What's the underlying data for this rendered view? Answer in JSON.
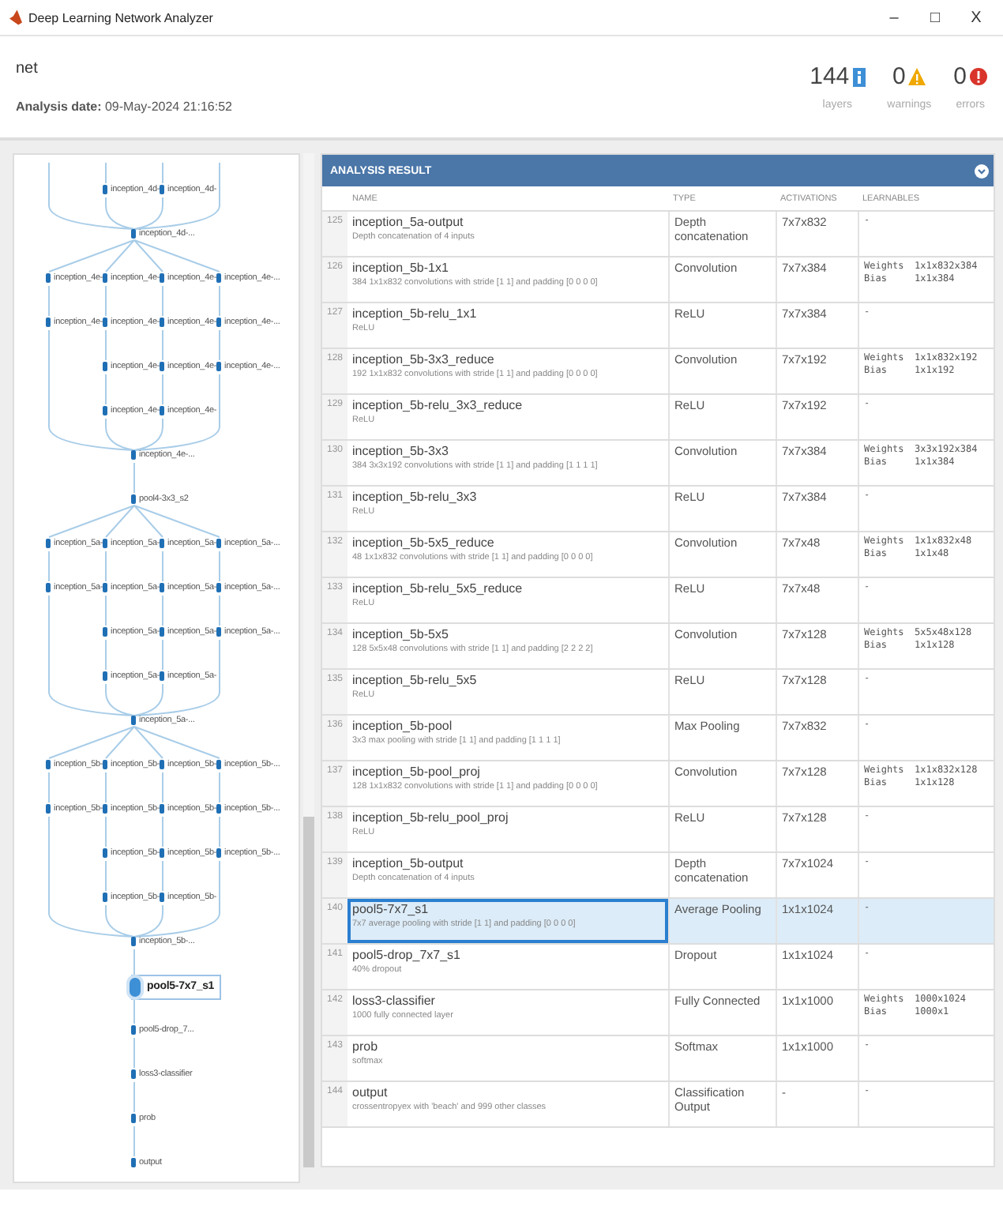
{
  "window": {
    "title": "Deep Learning Network Analyzer",
    "controls": [
      "–",
      "□",
      "X"
    ]
  },
  "header": {
    "network": "net",
    "analysis_date": "**Analysis date:** 09-May-2024 21:16:52",
    "stats": [
      {
        "kind": "info",
        "count": "144",
        "label": "layers"
      },
      {
        "kind": "warning",
        "count": "0",
        "label": "warnings"
      },
      {
        "kind": "error",
        "count": "0",
        "label": "errors"
      }
    ]
  },
  "graph": {
    "rows": [
      {
        "kind": "branch",
        "nodes": [
          {
            "kind": "gap"
          },
          {
            "kind": "node",
            "label": "inception_4d-",
            "selected": false
          },
          {
            "kind": "node",
            "label": "inception_4d-",
            "selected": false
          },
          {
            "kind": "gap"
          }
        ]
      },
      {
        "kind": "single",
        "node": {
          "label": "inception_4d-...",
          "selected": false
        }
      },
      {
        "kind": "branch",
        "nodes": [
          {
            "kind": "node",
            "label": "inception_4e-",
            "selected": false
          },
          {
            "kind": "node",
            "label": "inception_4e-",
            "selected": false
          },
          {
            "kind": "node",
            "label": "inception_4e-",
            "selected": false
          },
          {
            "kind": "node",
            "label": "inception_4e-...",
            "selected": false
          }
        ]
      },
      {
        "kind": "branch",
        "nodes": [
          {
            "kind": "node",
            "label": "inception_4e-",
            "selected": false
          },
          {
            "kind": "node",
            "label": "inception_4e-",
            "selected": false
          },
          {
            "kind": "node",
            "label": "inception_4e-",
            "selected": false
          },
          {
            "kind": "node",
            "label": "inception_4e-...",
            "selected": false
          }
        ]
      },
      {
        "kind": "branch",
        "nodes": [
          {
            "kind": "gap"
          },
          {
            "kind": "node",
            "label": "inception_4e-",
            "selected": false
          },
          {
            "kind": "node",
            "label": "inception_4e-",
            "selected": false
          },
          {
            "kind": "node",
            "label": "inception_4e-...",
            "selected": false
          }
        ]
      },
      {
        "kind": "branch",
        "nodes": [
          {
            "kind": "gap"
          },
          {
            "kind": "node",
            "label": "inception_4e-",
            "selected": false
          },
          {
            "kind": "node",
            "label": "inception_4e-",
            "selected": false
          },
          {
            "kind": "gap"
          }
        ]
      },
      {
        "kind": "single",
        "node": {
          "label": "inception_4e-...",
          "selected": false
        }
      },
      {
        "kind": "single",
        "node": {
          "label": "pool4-3x3_s2",
          "selected": false
        }
      },
      {
        "kind": "branch",
        "nodes": [
          {
            "kind": "node",
            "label": "inception_5a-",
            "selected": false
          },
          {
            "kind": "node",
            "label": "inception_5a-",
            "selected": false
          },
          {
            "kind": "node",
            "label": "inception_5a-",
            "selected": false
          },
          {
            "kind": "node",
            "label": "inception_5a-...",
            "selected": false
          }
        ]
      },
      {
        "kind": "branch",
        "nodes": [
          {
            "kind": "node",
            "label": "inception_5a-",
            "selected": false
          },
          {
            "kind": "node",
            "label": "inception_5a-",
            "selected": false
          },
          {
            "kind": "node",
            "label": "inception_5a-",
            "selected": false
          },
          {
            "kind": "node",
            "label": "inception_5a-...",
            "selected": false
          }
        ]
      },
      {
        "kind": "branch",
        "nodes": [
          {
            "kind": "gap"
          },
          {
            "kind": "node",
            "label": "inception_5a-",
            "selected": false
          },
          {
            "kind": "node",
            "label": "inception_5a-",
            "selected": false
          },
          {
            "kind": "node",
            "label": "inception_5a-...",
            "selected": false
          }
        ]
      },
      {
        "kind": "branch",
        "nodes": [
          {
            "kind": "gap"
          },
          {
            "kind": "node",
            "label": "inception_5a-",
            "selected": false
          },
          {
            "kind": "node",
            "label": "inception_5a-",
            "selected": false
          },
          {
            "kind": "gap"
          }
        ]
      },
      {
        "kind": "single",
        "node": {
          "label": "inception_5a-...",
          "selected": false
        }
      },
      {
        "kind": "branch",
        "nodes": [
          {
            "kind": "node",
            "label": "inception_5b-",
            "selected": false
          },
          {
            "kind": "node",
            "label": "inception_5b-",
            "selected": false
          },
          {
            "kind": "node",
            "label": "inception_5b-",
            "selected": false
          },
          {
            "kind": "node",
            "label": "inception_5b-...",
            "selected": false
          }
        ]
      },
      {
        "kind": "branch",
        "nodes": [
          {
            "kind": "node",
            "label": "inception_5b-",
            "selected": false
          },
          {
            "kind": "node",
            "label": "inception_5b-",
            "selected": false
          },
          {
            "kind": "node",
            "label": "inception_5b-",
            "selected": false
          },
          {
            "kind": "node",
            "label": "inception_5b-...",
            "selected": false
          }
        ]
      },
      {
        "kind": "branch",
        "nodes": [
          {
            "kind": "gap"
          },
          {
            "kind": "node",
            "label": "inception_5b-",
            "selected": false
          },
          {
            "kind": "node",
            "label": "inception_5b-",
            "selected": false
          },
          {
            "kind": "node",
            "label": "inception_5b-...",
            "selected": false
          }
        ]
      },
      {
        "kind": "branch",
        "nodes": [
          {
            "kind": "gap"
          },
          {
            "kind": "node",
            "label": "inception_5b-",
            "selected": false
          },
          {
            "kind": "node",
            "label": "inception_5b-",
            "selected": false
          },
          {
            "kind": "gap"
          }
        ]
      },
      {
        "kind": "single",
        "node": {
          "label": "inception_5b-...",
          "selected": false
        }
      },
      {
        "kind": "single",
        "node": {
          "label": "pool5-7x7_s1",
          "selected": true
        }
      },
      {
        "kind": "single",
        "node": {
          "label": "pool5-drop_7...",
          "selected": false
        }
      },
      {
        "kind": "single",
        "node": {
          "label": "loss3-classifier",
          "selected": false
        }
      },
      {
        "kind": "single",
        "node": {
          "label": "prob",
          "selected": false
        }
      },
      {
        "kind": "single",
        "node": {
          "label": "output",
          "selected": false
        }
      }
    ]
  },
  "results": {
    "title": "ANALYSIS RESULT",
    "columns": [
      "NAME",
      "TYPE",
      "ACTIVATIONS",
      "LEARNABLES"
    ],
    "rows": [
      {
        "index": "125",
        "name": "inception_5a-output",
        "description": "Depth concatenation of 4 inputs",
        "type": "Depth concatenation",
        "activations": "7x7x832",
        "learnables": [
          {
            "value": "-"
          }
        ],
        "selected": false
      },
      {
        "index": "126",
        "name": "inception_5b-1x1",
        "description": "384 1x1x832 convolutions with stride [1 1] and padding [0 0 0 0]",
        "type": "Convolution",
        "activations": "7x7x384",
        "learnables": [
          {
            "label": "Weights",
            "value": "1x1x832x384"
          },
          {
            "label": "Bias",
            "value": "1x1x384"
          }
        ],
        "selected": false
      },
      {
        "index": "127",
        "name": "inception_5b-relu_1x1",
        "description": "ReLU",
        "type": "ReLU",
        "activations": "7x7x384",
        "learnables": [
          {
            "value": "-"
          }
        ],
        "selected": false
      },
      {
        "index": "128",
        "name": "inception_5b-3x3_reduce",
        "description": "192 1x1x832 convolutions with stride [1 1] and padding [0 0 0 0]",
        "type": "Convolution",
        "activations": "7x7x192",
        "learnables": [
          {
            "label": "Weights",
            "value": "1x1x832x192"
          },
          {
            "label": "Bias",
            "value": "1x1x192"
          }
        ],
        "selected": false
      },
      {
        "index": "129",
        "name": "inception_5b-relu_3x3_reduce",
        "description": "ReLU",
        "type": "ReLU",
        "activations": "7x7x192",
        "learnables": [
          {
            "value": "-"
          }
        ],
        "selected": false
      },
      {
        "index": "130",
        "name": "inception_5b-3x3",
        "description": "384 3x3x192 convolutions with stride [1 1] and padding [1 1 1 1]",
        "type": "Convolution",
        "activations": "7x7x384",
        "learnables": [
          {
            "label": "Weights",
            "value": "3x3x192x384"
          },
          {
            "label": "Bias",
            "value": "1x1x384"
          }
        ],
        "selected": false
      },
      {
        "index": "131",
        "name": "inception_5b-relu_3x3",
        "description": "ReLU",
        "type": "ReLU",
        "activations": "7x7x384",
        "learnables": [
          {
            "value": "-"
          }
        ],
        "selected": false
      },
      {
        "index": "132",
        "name": "inception_5b-5x5_reduce",
        "description": "48 1x1x832 convolutions with stride [1 1] and padding [0 0 0 0]",
        "type": "Convolution",
        "activations": "7x7x48",
        "learnables": [
          {
            "label": "Weights",
            "value": "1x1x832x48"
          },
          {
            "label": "Bias",
            "value": "1x1x48"
          }
        ],
        "selected": false
      },
      {
        "index": "133",
        "name": "inception_5b-relu_5x5_reduce",
        "description": "ReLU",
        "type": "ReLU",
        "activations": "7x7x48",
        "learnables": [
          {
            "value": "-"
          }
        ],
        "selected": false
      },
      {
        "index": "134",
        "name": "inception_5b-5x5",
        "description": "128 5x5x48 convolutions with stride [1 1] and padding [2 2 2 2]",
        "type": "Convolution",
        "activations": "7x7x128",
        "learnables": [
          {
            "label": "Weights",
            "value": "5x5x48x128"
          },
          {
            "label": "Bias",
            "value": "1x1x128"
          }
        ],
        "selected": false
      },
      {
        "index": "135",
        "name": "inception_5b-relu_5x5",
        "description": "ReLU",
        "type": "ReLU",
        "activations": "7x7x128",
        "learnables": [
          {
            "value": "-"
          }
        ],
        "selected": false
      },
      {
        "index": "136",
        "name": "inception_5b-pool",
        "description": "3x3 max pooling with stride [1 1] and padding [1 1 1 1]",
        "type": "Max Pooling",
        "activations": "7x7x832",
        "learnables": [
          {
            "value": "-"
          }
        ],
        "selected": false
      },
      {
        "index": "137",
        "name": "inception_5b-pool_proj",
        "description": "128 1x1x832 convolutions with stride [1 1] and padding [0 0 0 0]",
        "type": "Convolution",
        "activations": "7x7x128",
        "learnables": [
          {
            "label": "Weights",
            "value": "1x1x832x128"
          },
          {
            "label": "Bias",
            "value": "1x1x128"
          }
        ],
        "selected": false
      },
      {
        "index": "138",
        "name": "inception_5b-relu_pool_proj",
        "description": "ReLU",
        "type": "ReLU",
        "activations": "7x7x128",
        "learnables": [
          {
            "value": "-"
          }
        ],
        "selected": false
      },
      {
        "index": "139",
        "name": "inception_5b-output",
        "description": "Depth concatenation of 4 inputs",
        "type": "Depth concatenation",
        "activations": "7x7x1024",
        "learnables": [
          {
            "value": "-"
          }
        ],
        "selected": false
      },
      {
        "index": "140",
        "name": "pool5-7x7_s1",
        "description": "7x7 average pooling with stride [1 1] and padding [0 0 0 0]",
        "type": "Average Pooling",
        "activations": "1x1x1024",
        "learnables": [
          {
            "value": "-"
          }
        ],
        "selected": true
      },
      {
        "index": "141",
        "name": "pool5-drop_7x7_s1",
        "description": "40% dropout",
        "type": "Dropout",
        "activations": "1x1x1024",
        "learnables": [
          {
            "value": "-"
          }
        ],
        "selected": false
      },
      {
        "index": "142",
        "name": "loss3-classifier",
        "description": "1000 fully connected layer",
        "type": "Fully Connected",
        "activations": "1x1x1000",
        "learnables": [
          {
            "label": "Weights",
            "value": "1000x1024"
          },
          {
            "label": "Bias",
            "value": "1000x1"
          }
        ],
        "selected": false
      },
      {
        "index": "143",
        "name": "prob",
        "description": "softmax",
        "type": "Softmax",
        "activations": "1x1x1000",
        "learnables": [
          {
            "value": "-"
          }
        ],
        "selected": false
      },
      {
        "index": "144",
        "name": "output",
        "description": "crossentropyex with 'beach' and 999 other classes",
        "type": "Classification Output",
        "activations": "-",
        "learnables": [
          {
            "value": "-"
          }
        ],
        "selected": false
      }
    ]
  }
}
